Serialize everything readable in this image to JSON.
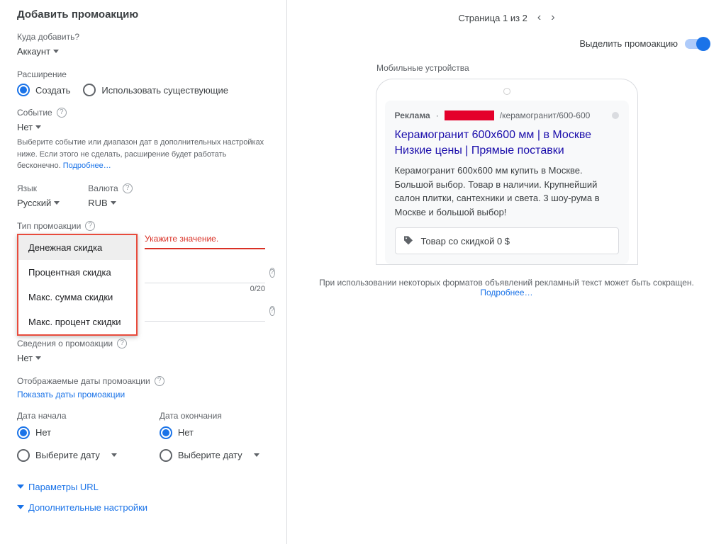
{
  "left": {
    "title": "Добавить промоакцию",
    "add_to": {
      "label": "Куда добавить?",
      "value": "Аккаунт"
    },
    "extension": {
      "label": "Расширение",
      "create": "Создать",
      "use_existing": "Использовать существующие"
    },
    "event": {
      "label": "Событие",
      "value": "Нет",
      "hint": "Выберите событие или диапазон дат в дополнительных настройках ниже. Если этого не сделать, расширение будет работать бесконечно.",
      "hint_link": "Подробнее…"
    },
    "language": {
      "label": "Язык",
      "value": "Русский"
    },
    "currency": {
      "label": "Валюта",
      "value": "RUB"
    },
    "promo_type": {
      "label": "Тип промоакции",
      "options": [
        "Денежная скидка",
        "Процентная скидка",
        "Макс. сумма скидки",
        "Макс. процент скидки"
      ],
      "error": "Укажите значение."
    },
    "item_field": {
      "counter": "0/20"
    },
    "promo_details": {
      "label": "Сведения о промоакции",
      "value": "Нет"
    },
    "display_dates": {
      "label": "Отображаемые даты промоакции",
      "link": "Показать даты промоакции"
    },
    "dates": {
      "start_label": "Дата начала",
      "end_label": "Дата окончания",
      "none": "Нет",
      "pick": "Выберите дату"
    },
    "url_params": "Параметры URL",
    "advanced": "Дополнительные настройки"
  },
  "right": {
    "pager": "Страница 1 из 2",
    "highlight": "Выделить промоакцию",
    "device_label": "Мобильные устройства",
    "ad": {
      "badge": "Реклама",
      "url_suffix": "/керамогранит/600-600",
      "title1": "Керамогранит 600х600 мм | в Москве",
      "title2": "Низкие цены | Прямые поставки",
      "desc": "Керамогранит 600х600 мм купить в Москве. Большой выбор. Товар в наличии. Крупнейший салон плитки, сантехники и света. 3 шоу-рума в Москве и большой выбор!",
      "ext_text": "Товар со скидкой 0 $"
    },
    "footer": "При использовании некоторых форматов объявлений рекламный текст может быть сокращен.",
    "footer_link": "Подробнее…"
  }
}
